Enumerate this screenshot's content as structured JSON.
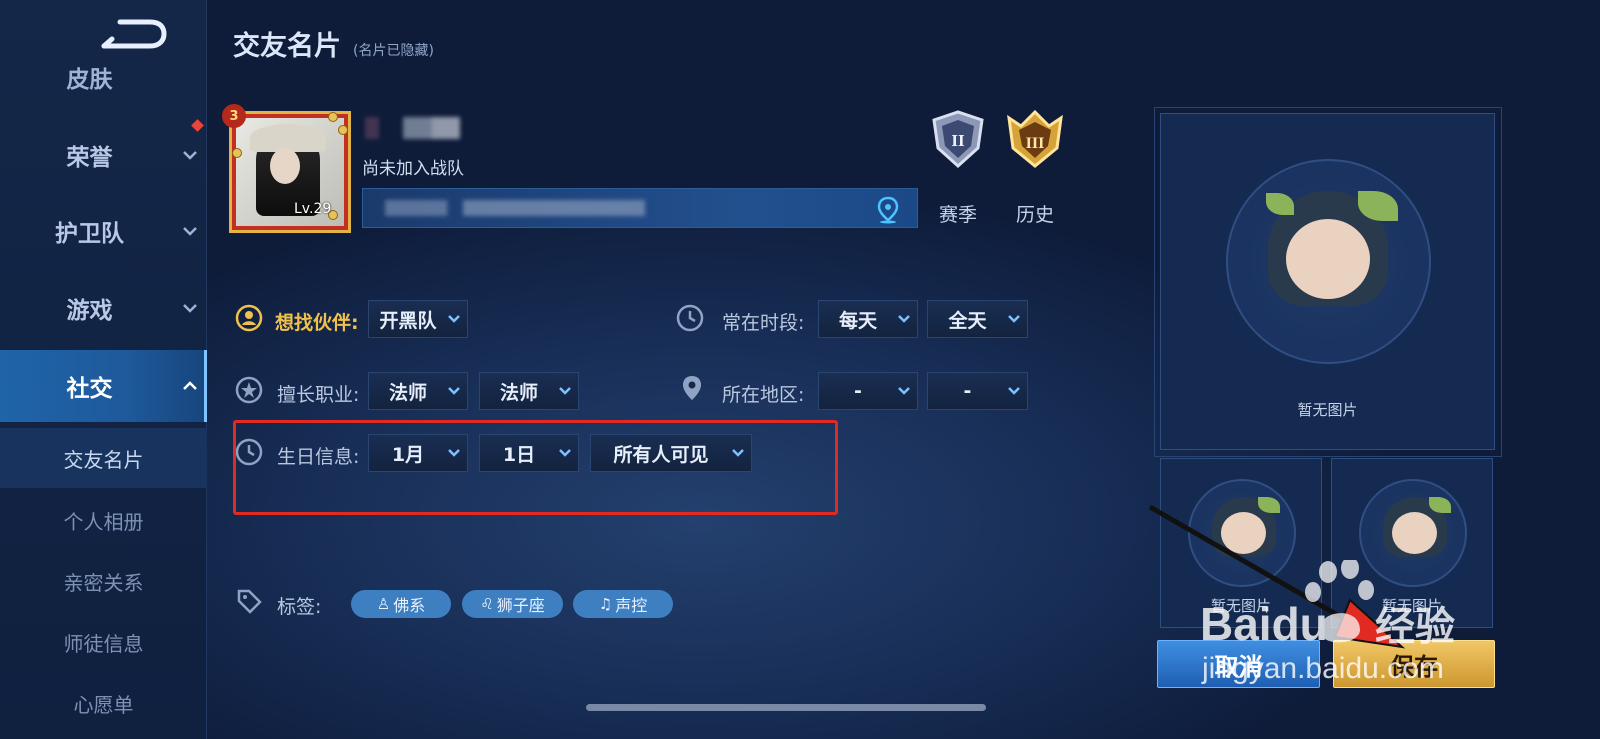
{
  "header": {
    "title": "交友名片",
    "subtitle": "(名片已隐藏)"
  },
  "sidebar": {
    "items": [
      {
        "label": "皮肤"
      },
      {
        "label": "荣誉"
      },
      {
        "label": "护卫队"
      },
      {
        "label": "游戏"
      },
      {
        "label": "社交"
      }
    ],
    "sub_items": [
      {
        "label": "交友名片"
      },
      {
        "label": "个人相册"
      },
      {
        "label": "亲密关系"
      },
      {
        "label": "师徒信息"
      },
      {
        "label": "心愿单"
      }
    ]
  },
  "profile": {
    "rank": "3",
    "level": "Lv.29",
    "team": "尚未加入战队"
  },
  "season_buttons": [
    {
      "label": "赛季",
      "tier": "II"
    },
    {
      "label": "历史",
      "tier": "III"
    }
  ],
  "fields": {
    "partner": {
      "label": "想找伙伴:",
      "value": "开黑队"
    },
    "time": {
      "label": "常在时段:",
      "values": [
        "每天",
        "全天"
      ]
    },
    "role": {
      "label": "擅长职业:",
      "values": [
        "法师",
        "法师"
      ]
    },
    "region": {
      "label": "所在地区:",
      "values": [
        "-",
        "-"
      ]
    },
    "birthday": {
      "label": "生日信息:",
      "month": "1月",
      "day": "1日",
      "visibility": "所有人可见"
    }
  },
  "tags": {
    "label": "标签:",
    "items": [
      "佛系",
      "狮子座",
      "声控"
    ]
  },
  "pictures": {
    "main_label": "暂无图片",
    "small": [
      "暂无图片",
      "暂无图片"
    ]
  },
  "buttons": {
    "cancel": "取消",
    "save": "保存"
  },
  "watermark": {
    "brand": "Baidu",
    "brand_cn": "经验",
    "url": "jingyan.baidu.com"
  },
  "colors": {
    "accent_gold": "#f0c24a",
    "active_nav": "#1f64a8",
    "highlight_red": "#e02a22"
  }
}
